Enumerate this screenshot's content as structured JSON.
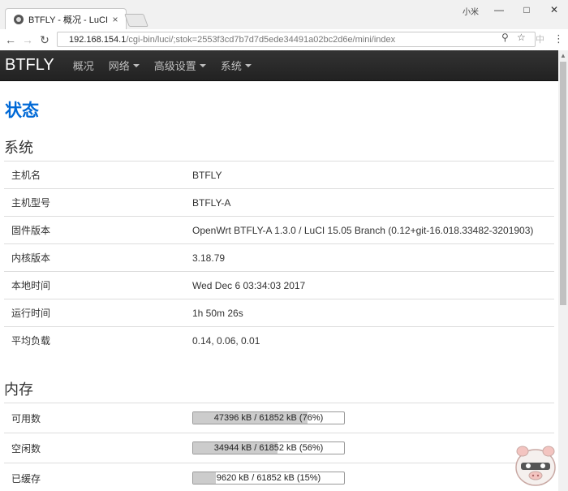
{
  "browser": {
    "tab_title": "BTFLY - 概况 - LuCI",
    "tab_close": "×",
    "user_label": "小米",
    "url_host": "192.168.154.1",
    "url_path": "/cgi-bin/luci/;stok=2553f3cd7b7d7d5ede34491a02bc2d6e/mini/index",
    "ime_label": "中"
  },
  "navbar": {
    "brand": "BTFLY",
    "items": [
      "概况",
      "网络",
      "高级设置",
      "系统"
    ]
  },
  "page_title": "状态",
  "system": {
    "heading": "系统",
    "rows": [
      {
        "label": "主机名",
        "value": "BTFLY"
      },
      {
        "label": "主机型号",
        "value": "BTFLY-A"
      },
      {
        "label": "固件版本",
        "value": "OpenWrt BTFLY-A 1.3.0 / LuCI 15.05 Branch (0.12+git-16.018.33482-3201903)"
      },
      {
        "label": "内核版本",
        "value": "3.18.79"
      },
      {
        "label": "本地时间",
        "value": "Wed Dec 6 03:34:03 2017"
      },
      {
        "label": "运行时间",
        "value": "1h 50m 26s"
      },
      {
        "label": "平均负载",
        "value": "0.14, 0.06, 0.01"
      }
    ]
  },
  "memory": {
    "heading": "内存",
    "rows": [
      {
        "label": "可用数",
        "text": "47396 kB / 61852 kB (76%)",
        "fraction": 0.76
      },
      {
        "label": "空闲数",
        "text": "34944 kB / 61852 kB (56%)",
        "fraction": 0.56
      },
      {
        "label": "已缓存",
        "text": "9620 kB / 61852 kB (15%)",
        "fraction": 0.15
      }
    ]
  }
}
